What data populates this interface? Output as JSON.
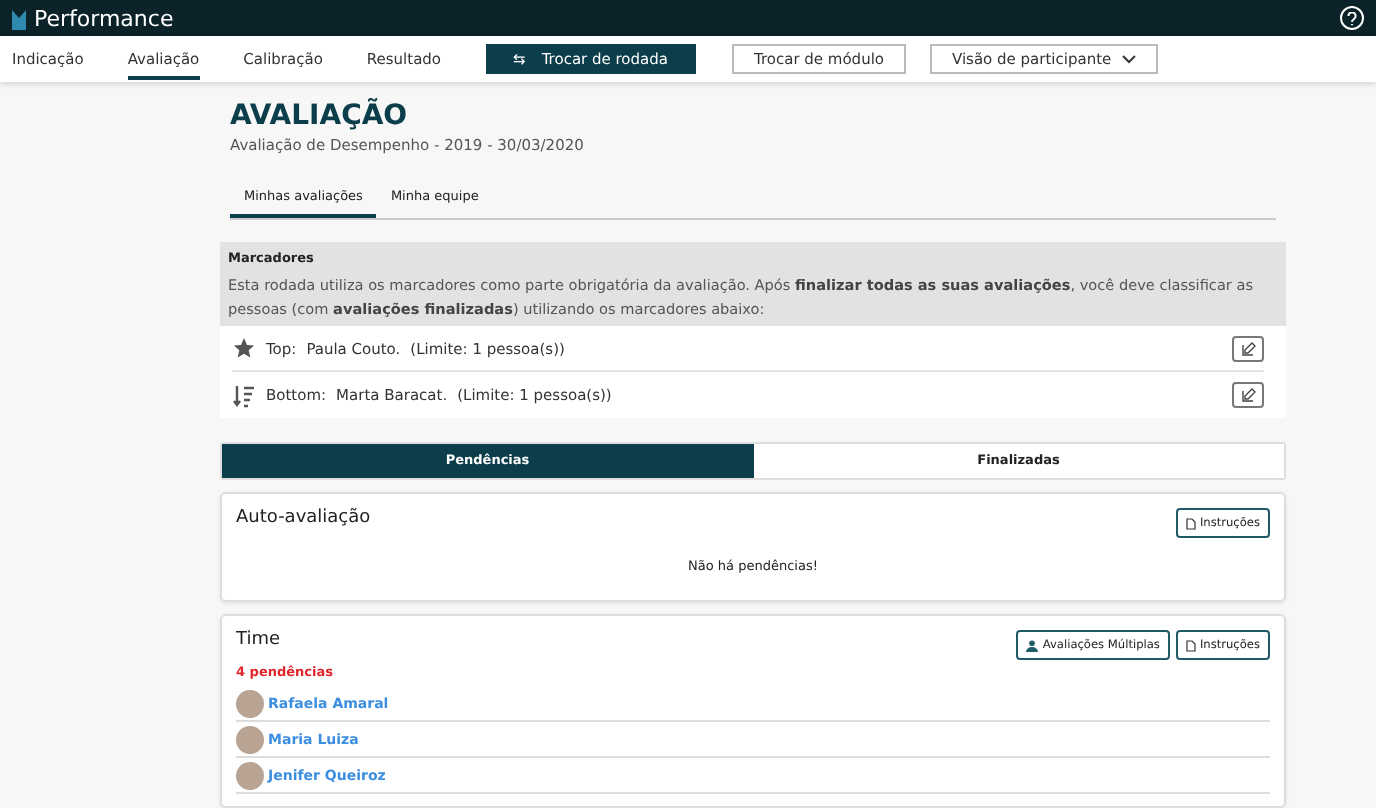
{
  "app": {
    "title": "Performance"
  },
  "nav": {
    "items": [
      {
        "label": "Indicação",
        "selected": false
      },
      {
        "label": "Avaliação",
        "selected": true
      },
      {
        "label": "Calibração",
        "selected": false
      },
      {
        "label": "Resultado",
        "selected": false
      }
    ],
    "round_button": {
      "icon": "⇆",
      "label": "Trocar de rodada"
    },
    "module_button": "Trocar de módulo",
    "view_select": "Visão de participante"
  },
  "page": {
    "title": "AVALIAÇÃO",
    "subtitle": "Avaliação de Desempenho - 2019 - 30/03/2020"
  },
  "subtabs": [
    {
      "label": "Minhas avaliações",
      "selected": true
    },
    {
      "label": "Minha equipe",
      "selected": false
    }
  ],
  "markers": {
    "title": "Marcadores",
    "description": "Esta rodada utiliza os marcadores como parte obrigatória da avaliação. Após **finalizar todas as suas avaliações**, você deve classificar as pessoas (com **avaliações finalizadas**) utilizando os marcadores abaixo:",
    "rows": [
      {
        "kind": "top",
        "label": "Top:",
        "name": "Paula Couto.",
        "limit": "(Limite: 1 pessoa(s))"
      },
      {
        "kind": "bottom",
        "label": "Bottom:",
        "name": "Marta Baracat.",
        "limit": "(Limite: 1 pessoa(s))"
      }
    ]
  },
  "status_tabs": [
    {
      "label": "Pendências",
      "selected": true
    },
    {
      "label": "Finalizadas",
      "selected": false
    }
  ],
  "self_review": {
    "title": "Auto-avaliação",
    "instructions": "Instruções",
    "empty": "Não há pendências!"
  },
  "team": {
    "title": "Time",
    "multi_button": "Avaliações Múltiplas",
    "instructions": "Instruções",
    "pending": "4 pendências",
    "people": [
      {
        "name": "Rafaela Amaral"
      },
      {
        "name": "Maria Luiza"
      },
      {
        "name": "Jenifer Queiroz"
      }
    ]
  }
}
